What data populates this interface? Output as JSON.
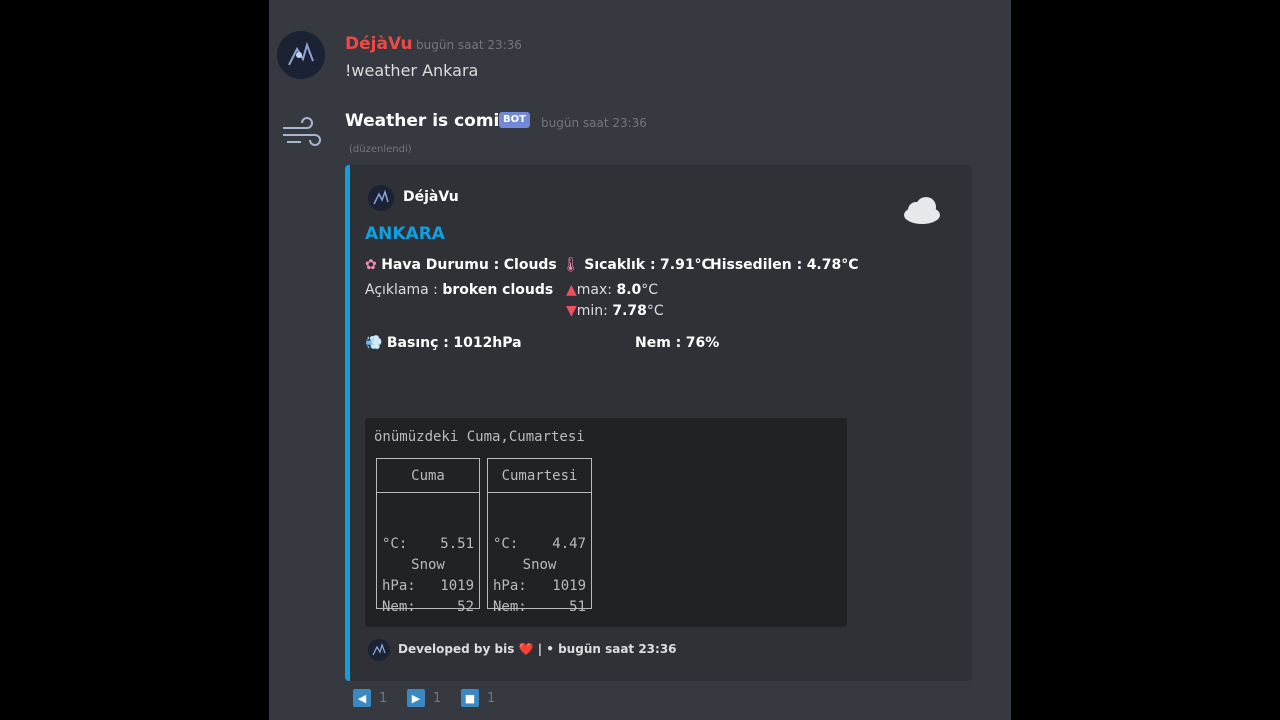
{
  "messages": [
    {
      "username": "DéjàVu",
      "username_color": "#f04747",
      "timestamp": "bugün saat 23:36",
      "text": "!weather Ankara",
      "avatar_icon": "dark-anime-avatar-icon"
    },
    {
      "username": "Weather is comin'",
      "bot_tag": "BOT",
      "timestamp": "bugün saat 23:36",
      "edited": "(düzenlendi)",
      "avatar_icon": "wind-icon"
    }
  ],
  "embed": {
    "accent_color": "#10a0e0",
    "author": "DéjàVu",
    "title": "ANKARA",
    "thumbnail_icon": "cloud-icon",
    "fields": {
      "hava_label": "Hava Durumu :",
      "hava_value": "Clouds",
      "sicaklik_label": "Sıcaklık :",
      "sicaklik_value": "7.91°C",
      "hissedilen_label": "Hissedilen :",
      "hissedilen_value": "4.78°C",
      "aciklama_label": "Açıklama :",
      "aciklama_value": "broken clouds",
      "max_label": "max:",
      "max_value": "8.0",
      "max_unit": "°C",
      "min_label": "min:",
      "min_value": "7.78",
      "min_unit": "°C",
      "basinc_label": "Basınç :",
      "basinc_value": "1012hPa",
      "nem_label": "Nem :",
      "nem_value": "76%"
    },
    "code_block": {
      "heading": "önümüzdeki Cuma,Cumartesi",
      "days": [
        {
          "name": "Cuma",
          "c_label": "°C:",
          "c_value": "5.51",
          "cond": "Snow",
          "hpa_label": "hPa:",
          "hpa_value": "1019",
          "nem_label": "Nem:",
          "nem_value": "52"
        },
        {
          "name": "Cumartesi",
          "c_label": "°C:",
          "c_value": "4.47",
          "cond": "Snow",
          "hpa_label": "hPa:",
          "hpa_value": "1019",
          "nem_label": "Nem:",
          "nem_value": "51"
        }
      ]
    },
    "footer": {
      "text": "Developed by bis",
      "heart": "❤️",
      "sep": "| • bugün saat 23:36"
    }
  },
  "reactions": [
    {
      "icon": "left-arrow-icon",
      "glyph": "◀",
      "count": "1"
    },
    {
      "icon": "right-arrow-icon",
      "glyph": "▶",
      "count": "1"
    },
    {
      "icon": "stop-icon",
      "glyph": "■",
      "count": "1"
    }
  ]
}
